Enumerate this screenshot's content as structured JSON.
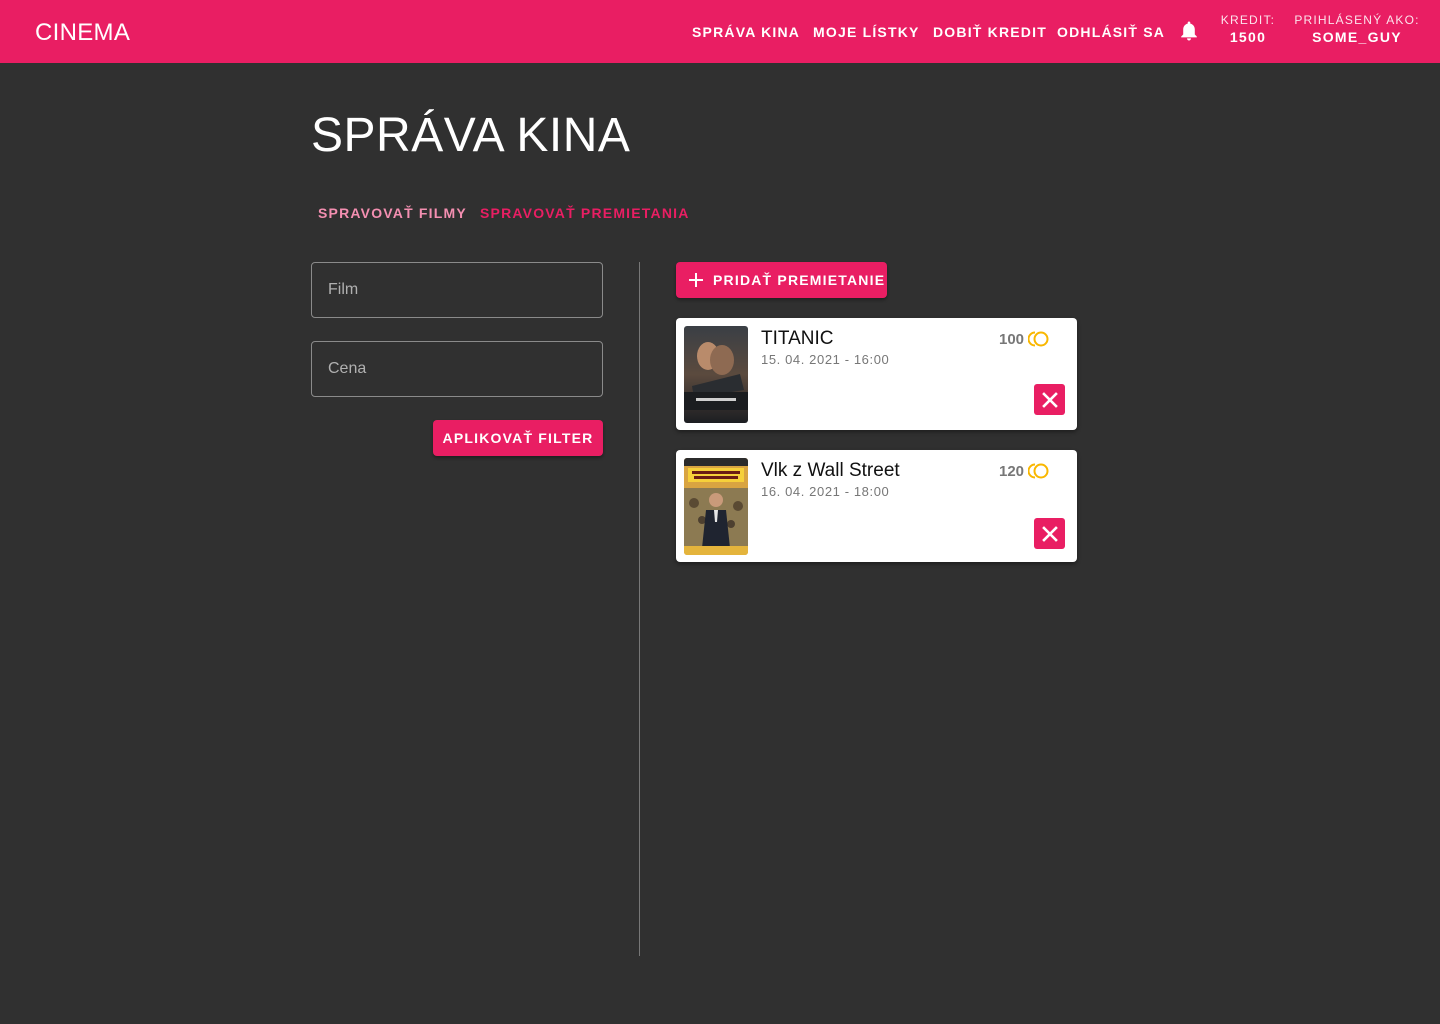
{
  "app": {
    "logo": "CINEMA"
  },
  "nav": {
    "items": [
      {
        "label": "SPRÁVA KINA"
      },
      {
        "label": "MOJE LÍSTKY"
      },
      {
        "label": "DOBIŤ KREDIT"
      },
      {
        "label": "ODHLÁSIŤ SA"
      }
    ],
    "credit_label": "KREDIT:",
    "credit_value": "1500",
    "user_label": "PRIHLÁSENÝ AKO:",
    "user_value": "SOME_GUY"
  },
  "page": {
    "title": "SPRÁVA KINA",
    "tabs": [
      {
        "label": "SPRAVOVAŤ FILMY",
        "active": false
      },
      {
        "label": "SPRAVOVAŤ PREMIETANIA",
        "active": true
      }
    ]
  },
  "filter": {
    "film_placeholder": "Film",
    "price_placeholder": "Cena",
    "apply_label": "APLIKOVAŤ FILTER"
  },
  "screenings": {
    "add_label": "PRIDAŤ PREMIETANIE",
    "items": [
      {
        "title": "TITANIC",
        "datetime": "15. 04. 2021 - 16:00",
        "price": "100"
      },
      {
        "title": "Vlk z Wall Street",
        "datetime": "16. 04. 2021 - 18:00",
        "price": "120"
      }
    ]
  },
  "colors": {
    "accent": "#e91e63",
    "background": "#303030",
    "coin": "#f9b700"
  }
}
